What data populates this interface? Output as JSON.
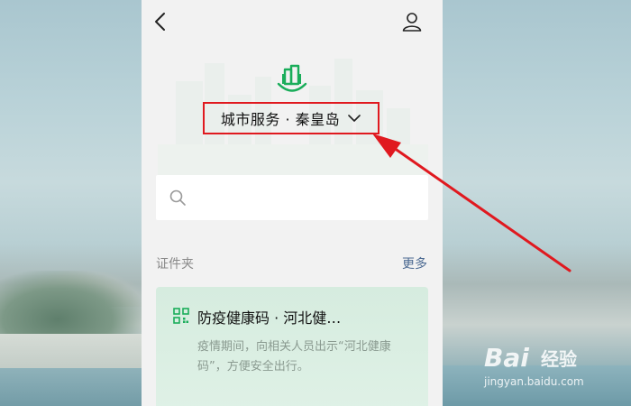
{
  "header": {
    "back_icon": "chevron-left-icon",
    "profile_icon": "user-icon"
  },
  "city_selector": {
    "label": "城市服务 · 秦皇岛",
    "logo_icon": "city-buildings-icon",
    "highlight_color": "#e0191f"
  },
  "search": {
    "icon": "search-icon",
    "placeholder": ""
  },
  "documents_section": {
    "title": "证件夹",
    "more_label": "更多"
  },
  "health_card": {
    "icon": "qr-code-icon",
    "title": "防疫健康码 · 河北健…",
    "description": "疫情期间，向相关人员出示“河北健康码”，方便安全出行。"
  },
  "watermark": {
    "brand": "Bai",
    "suffix": "经验",
    "url": "jingyan.baidu.com"
  },
  "colors": {
    "accent_green": "#1aad5a",
    "link_blue": "#4c6a92",
    "annotation_red": "#e0191f"
  }
}
